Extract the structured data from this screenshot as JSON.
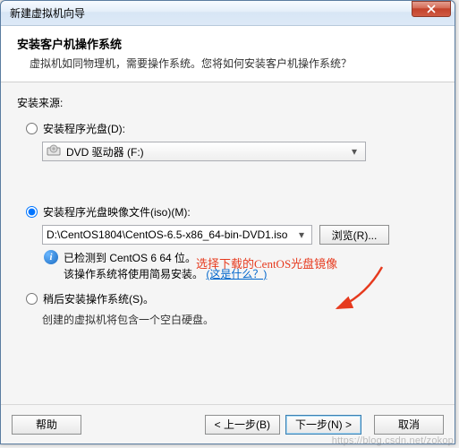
{
  "window": {
    "title": "新建虚拟机向导"
  },
  "header": {
    "title": "安装客户机操作系统",
    "subtitle": "虚拟机如同物理机，需要操作系统。您将如何安装客户机操作系统？"
  },
  "body": {
    "source_label": "安装来源:",
    "option_disc": {
      "label": "安装程序光盘(D):",
      "selected": false,
      "dropdown_text": "DVD 驱动器 (F:)"
    },
    "option_iso": {
      "label": "安装程序光盘映像文件(iso)(M):",
      "selected": true,
      "path": "D:\\CentOS1804\\CentOS-6.5-x86_64-bin-DVD1.iso",
      "browse_label": "浏览(R)...",
      "info_line1": "已检测到 CentOS 6 64 位。",
      "info_line2_prefix": "该操作系统将使用简易安装。",
      "info_link": "(这是什么？)"
    },
    "option_later": {
      "label": "稍后安装操作系统(S)。",
      "selected": false,
      "sub": "创建的虚拟机将包含一个空白硬盘。"
    },
    "annotation_text": "选择下载的CentOS光盘镜像"
  },
  "footer": {
    "help": "帮助",
    "back": "< 上一步(B)",
    "next": "下一步(N) >",
    "cancel": "取消"
  },
  "watermark": "https://blog.csdn.net/zokop"
}
